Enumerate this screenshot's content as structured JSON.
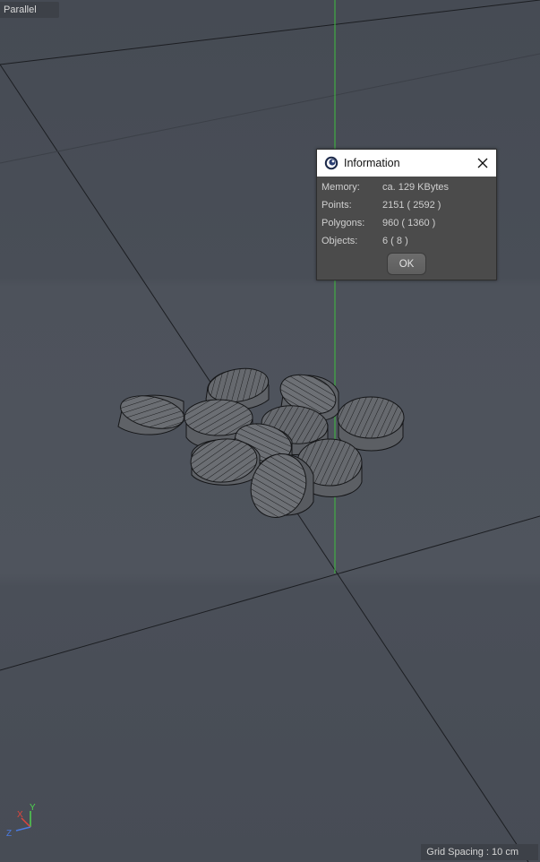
{
  "viewport": {
    "camera_label": "Parallel",
    "grid_spacing_text": "Grid Spacing : 10 cm",
    "axes": {
      "x": "X",
      "y": "Y",
      "z": "Z"
    },
    "colors": {
      "background": "#4a4f58",
      "y_axis_line": "#3fbf3f",
      "grid_line": "#1e2024",
      "wire": "#1a1a1a",
      "object": "#6a6d72"
    }
  },
  "dialog": {
    "title": "Information",
    "app_icon": "cinema4d-logo-icon",
    "close_icon": "close-icon",
    "rows": [
      {
        "label": "Memory:",
        "value": "ca. 129 KBytes"
      },
      {
        "label": "Points:",
        "value": "2151 ( 2592 )"
      },
      {
        "label": "Polygons:",
        "value": "960 ( 1360 )"
      },
      {
        "label": "Objects:",
        "value": "6 ( 8 )"
      }
    ],
    "ok_label": "OK"
  }
}
